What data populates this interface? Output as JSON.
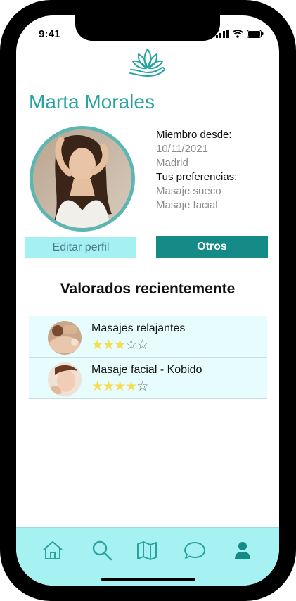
{
  "status_bar": {
    "time": "9:41"
  },
  "profile": {
    "name": "Marta Morales",
    "member_since_label": "Miembro desde:",
    "member_since": "10/11/2021",
    "city": "Madrid",
    "preferences_label": "Tus preferencias:",
    "preferences": [
      "Masaje sueco",
      "Masaje facial"
    ]
  },
  "buttons": {
    "edit_profile": "Editar perfil",
    "others": "Otros"
  },
  "recent": {
    "title": "Valorados recientemente",
    "items": [
      {
        "title": "Masajes relajantes",
        "rating": 3,
        "max": 5
      },
      {
        "title": "Masaje facial - Kobido",
        "rating": 4,
        "max": 5
      }
    ]
  },
  "tabs": [
    "home-icon",
    "search-icon",
    "map-icon",
    "chat-icon",
    "profile-icon"
  ],
  "colors": {
    "accent": "#2aa3a0",
    "primary_button": "#148b86",
    "light_button": "#a4f0f2",
    "tabbar": "#a6f2f3",
    "star": "#f7dc4b"
  }
}
